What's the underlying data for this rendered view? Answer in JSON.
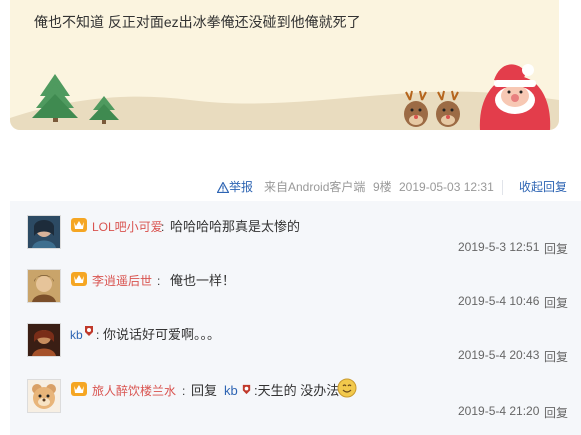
{
  "post": {
    "text": "俺也不知道 反正对面ez出冰拳俺还没碰到他俺就死了"
  },
  "meta": {
    "report_label": "举报",
    "source": "来自Android客户端",
    "floor": "9楼",
    "date": "2019-05-03 12:31",
    "collapse_label": "收起回复"
  },
  "replies": [
    {
      "username": "LOL吧小可爱",
      "colon": ":",
      "text": "哈哈哈哈那真是太惨的",
      "time": "2019-5-3 12:51",
      "reply_label": "回复"
    },
    {
      "username": "李逍遥后世",
      "colon": ":",
      "text": "俺也一样！",
      "time": "2019-5-4 10:46",
      "reply_label": "回复"
    },
    {
      "username": "kb",
      "colon": ":",
      "text": "你说话好可爱啊。。。",
      "time": "2019-5-4 20:43",
      "reply_label": "回复"
    },
    {
      "username": "旅人醉饮楼兰水",
      "colon": ":",
      "reply_prefix": "回复",
      "mention": "kb",
      "text": ":天生的 没办法",
      "time": "2019-5-4 21:20",
      "reply_label": "回复"
    }
  ],
  "colors": {
    "link_blue": "#2d64b3",
    "name_red": "#d9534f",
    "card_bg": "#fbf4df",
    "reply_bg": "#f5f7fa"
  },
  "icons": [
    "warning-icon",
    "member-badge-icon",
    "santa-icon",
    "reindeer-icon",
    "christmas-tree-icon",
    "emoji-icon"
  ]
}
